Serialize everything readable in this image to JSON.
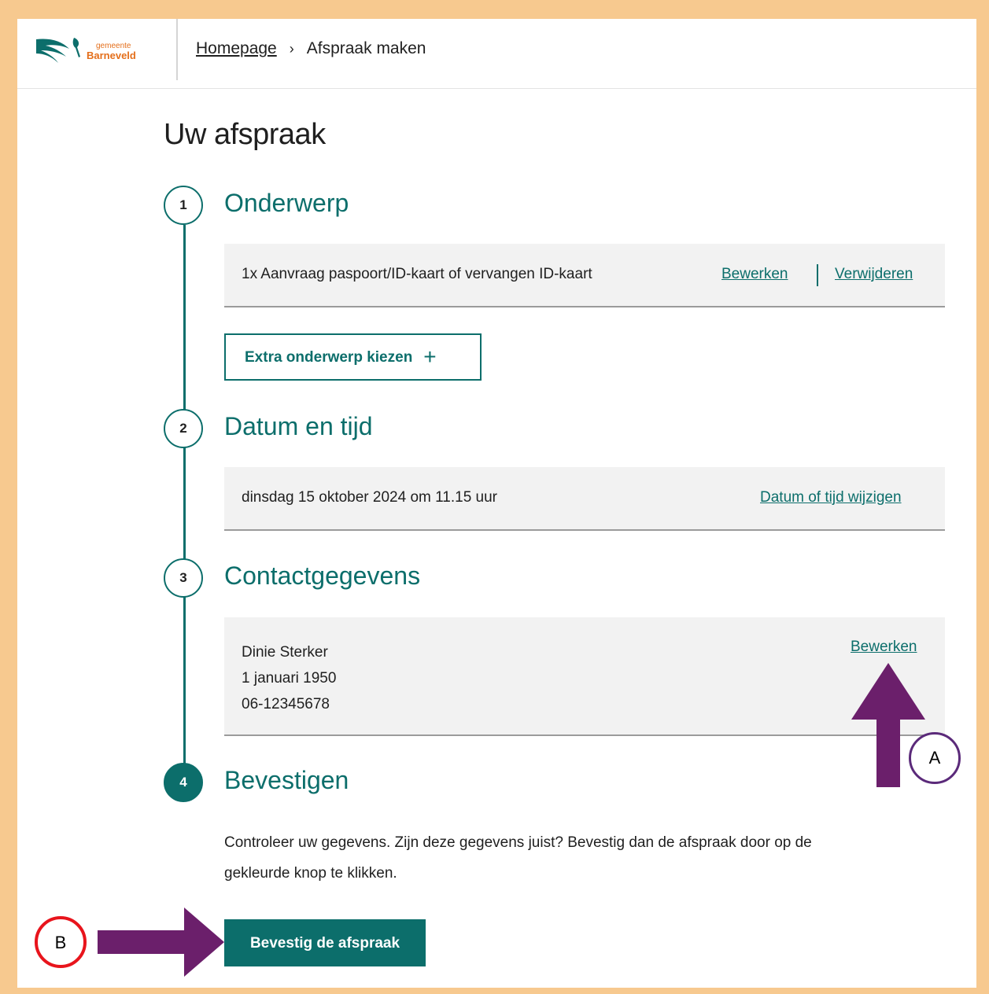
{
  "header": {
    "logo_small": "gemeente",
    "logo_name": "Barneveld",
    "breadcrumb_home": "Homepage",
    "breadcrumb_separator": "›",
    "breadcrumb_current": "Afspraak maken"
  },
  "page": {
    "title": "Uw afspraak"
  },
  "steps": [
    {
      "number": "1",
      "title": "Onderwerp",
      "item": "1x Aanvraag paspoort/ID-kaart of vervangen ID-kaart",
      "edit_label": "Bewerken",
      "remove_label": "Verwijderen",
      "extra_label": "Extra onderwerp kiezen",
      "extra_icon": "+"
    },
    {
      "number": "2",
      "title": "Datum en tijd",
      "value": "dinsdag 15 oktober 2024 om 11.15 uur",
      "change_label": "Datum of tijd wijzigen"
    },
    {
      "number": "3",
      "title": "Contactgegevens",
      "name": "Dinie Sterker",
      "birthdate": "1 januari 1950",
      "phone": "06-12345678",
      "edit_label": "Bewerken"
    },
    {
      "number": "4",
      "title": "Bevestigen",
      "instruction": "Controleer uw gegevens. Zijn deze gegevens juist? Bevestig dan de afspraak door op de gekleurde knop te klikken.",
      "confirm_label": "Bevestig de afspraak"
    }
  ],
  "annotations": {
    "marker_a": "A",
    "marker_b": "B"
  },
  "colors": {
    "accent": "#0c6e6b",
    "frame": "#f7c98f",
    "annotation_arrow": "#6b1f6b",
    "marker_a_ring": "#5b2a7a",
    "marker_b_ring": "#e8141c",
    "logo": "#e46f1b"
  }
}
